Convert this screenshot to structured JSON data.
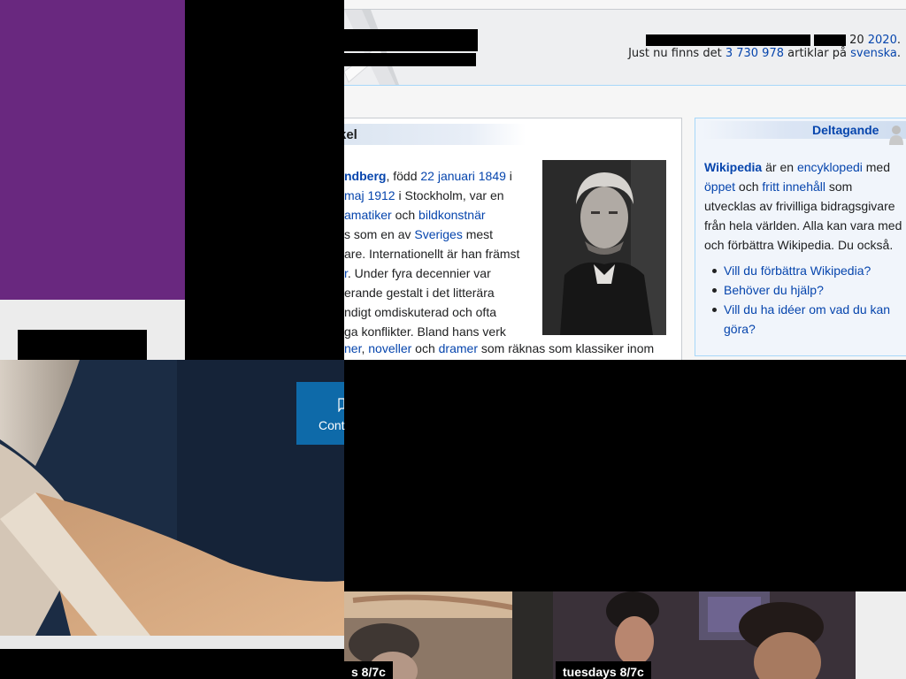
{
  "wiki": {
    "stats_line1_suffix": "20",
    "stats_line1_year": "2020",
    "stats_line1_end": ".",
    "stats_line2_prefix": "Just nu finns det",
    "stats_line2_count": "3 730 978",
    "stats_line2_mid": "artiklar på",
    "stats_line2_lang": "svenska",
    "stats_line2_end": ".",
    "article": {
      "title_fragment": "kel",
      "lines": [
        {
          "parts": [
            {
              "t": "ndberg",
              "link": true,
              "bold": true
            },
            {
              "t": ", född "
            },
            {
              "t": "22 januari 1849",
              "link": true
            },
            {
              "t": " i"
            }
          ]
        },
        {
          "parts": [
            {
              "t": "maj 1912",
              "link": true
            },
            {
              "t": " i Stockholm, var en"
            }
          ]
        },
        {
          "parts": [
            {
              "t": "amatiker",
              "link": true
            },
            {
              "t": " och "
            },
            {
              "t": "bildkonstnär",
              "link": true
            }
          ]
        },
        {
          "parts": [
            {
              "t": "s som en av "
            },
            {
              "t": "Sveriges",
              "link": true
            },
            {
              "t": " mest"
            }
          ]
        },
        {
          "parts": [
            {
              "t": "are. Internationellt är han främst"
            }
          ]
        },
        {
          "parts": [
            {
              "t": "r",
              "link": true
            },
            {
              "t": ". Under fyra decennier var"
            }
          ]
        },
        {
          "parts": [
            {
              "t": "erande gestalt i det litterära"
            }
          ]
        },
        {
          "parts": [
            {
              "t": "ndigt omdiskuterad och ofta"
            }
          ]
        },
        {
          "parts": [
            {
              "t": "ga konflikter. Bland hans verk"
            }
          ]
        }
      ],
      "last_line": [
        {
          "t": "ner",
          "link": true
        },
        {
          "t": ", "
        },
        {
          "t": "noveller",
          "link": true
        },
        {
          "t": " och "
        },
        {
          "t": "dramer",
          "link": true
        },
        {
          "t": " som räknas som klassiker inom"
        }
      ]
    },
    "participation": {
      "title": "Deltagande",
      "intro": [
        {
          "t": "Wikipedia",
          "link": true,
          "bold": true
        },
        {
          "t": " är en "
        },
        {
          "t": "encyklopedi",
          "link": true
        },
        {
          "t": " med "
        },
        {
          "t": "öppet",
          "link": true
        },
        {
          "t": " och "
        },
        {
          "t": "fritt innehåll",
          "link": true
        },
        {
          "t": " som utvecklas av frivilliga bidragsgivare från hela världen. Alla kan vara med och förbättra Wikipedia. Du också."
        }
      ],
      "links": [
        "Vill du förbättra Wikipedia?",
        "Behöver du hjälp?",
        "Vill du ha idéer om vad du kan göra?"
      ]
    }
  },
  "contact_button": {
    "label": "Cont"
  },
  "thumbnails": [
    {
      "airtime": "s 8/7c"
    },
    {
      "airtime": "tuesdays 8/7c"
    }
  ],
  "colors": {
    "purple_panel": "#69287f",
    "wiki_link": "#0645ad",
    "contact_button": "#0e6aa9"
  }
}
